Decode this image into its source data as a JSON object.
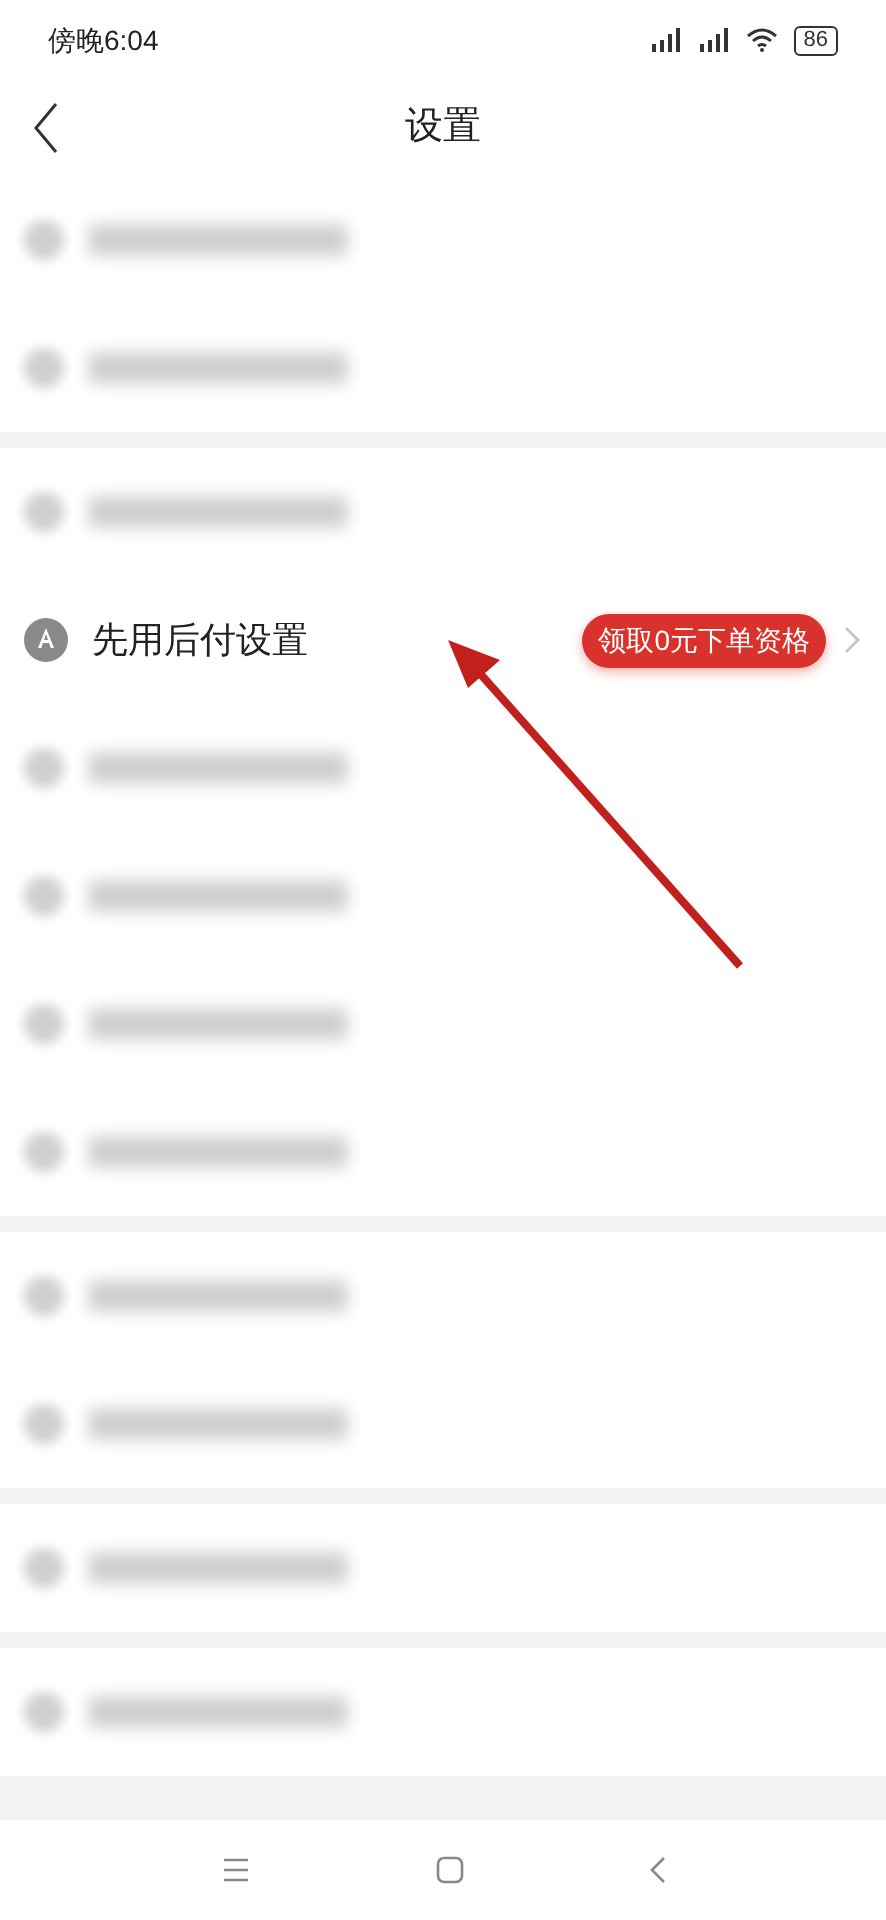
{
  "status_bar": {
    "time": "傍晚6:04",
    "battery": "86"
  },
  "header": {
    "title": "设置"
  },
  "groups": [
    {
      "rows": [
        {
          "kind": "blurred"
        },
        {
          "kind": "blurred"
        }
      ]
    },
    {
      "rows": [
        {
          "kind": "blurred"
        },
        {
          "kind": "setting",
          "label": "先用后付设置",
          "badge": "领取0元下单资格"
        },
        {
          "kind": "blurred"
        },
        {
          "kind": "blurred"
        },
        {
          "kind": "blurred"
        },
        {
          "kind": "blurred"
        }
      ]
    },
    {
      "rows": [
        {
          "kind": "blurred"
        },
        {
          "kind": "blurred"
        }
      ]
    },
    {
      "rows": [
        {
          "kind": "blurred"
        }
      ]
    },
    {
      "rows": [
        {
          "kind": "blurred"
        }
      ]
    }
  ]
}
